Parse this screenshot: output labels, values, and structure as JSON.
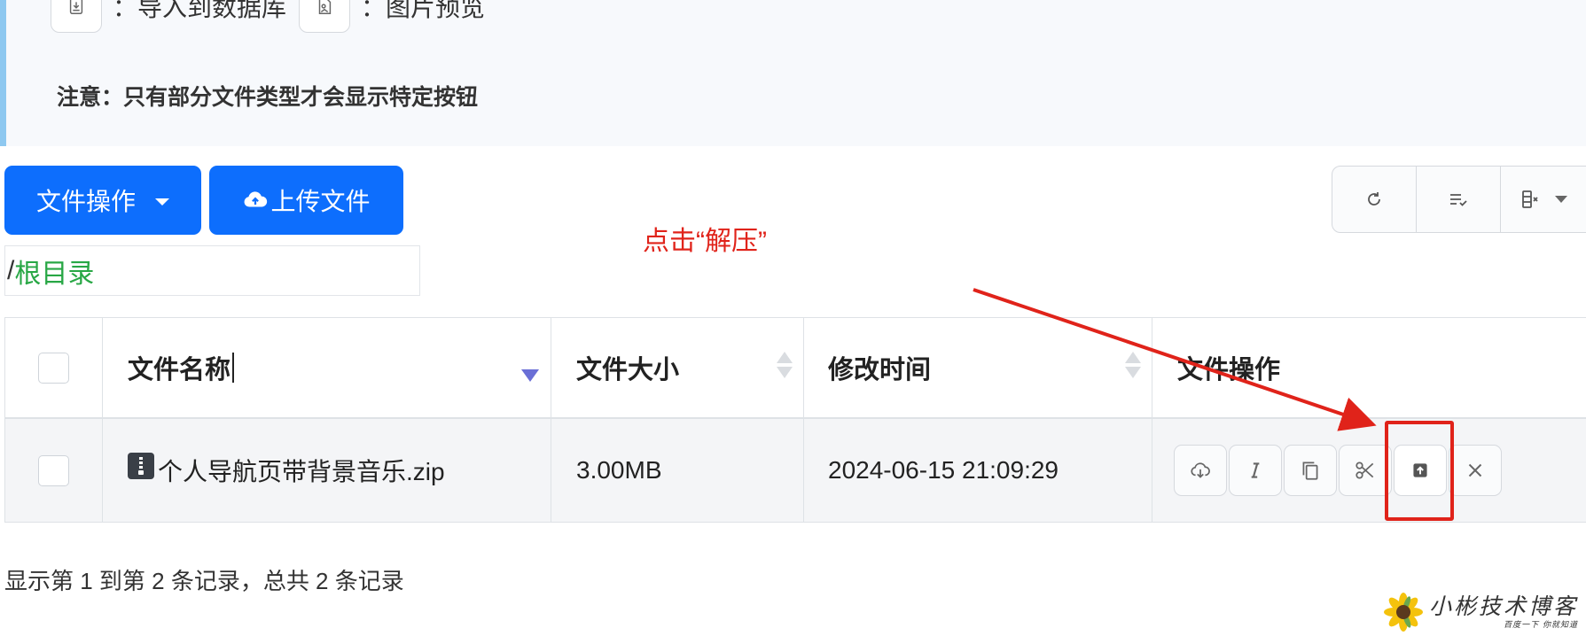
{
  "notice": {
    "legend_items": [
      {
        "icon": "import-database-icon",
        "text": "：导入到数据库"
      },
      {
        "icon": "image-preview-icon",
        "text": "：图片预览"
      }
    ],
    "note": "注意：只有部分文件类型才会显示特定按钮",
    "accent_color": "#8ec8f0"
  },
  "toolbar": {
    "file_ops_label": "文件操作",
    "upload_label": "上传文件",
    "primary_color": "#0d6efd",
    "right_tools": [
      {
        "icon": "refresh-icon"
      },
      {
        "icon": "toggle-view-icon"
      },
      {
        "icon": "columns-icon"
      }
    ]
  },
  "breadcrumb": {
    "separator": "/",
    "root": "根目录",
    "root_color": "#28a745"
  },
  "annotation": {
    "text": "点击“解压”",
    "color": "#e0231a"
  },
  "table": {
    "headers": {
      "name": "文件名称",
      "size": "文件大小",
      "modified": "修改时间",
      "ops": "文件操作"
    },
    "rows": [
      {
        "icon": "zip-file-icon",
        "name": "个人导航页带背景音乐.zip",
        "size": "3.00MB",
        "modified": "2024-06-15 21:09:29",
        "actions": [
          "download-icon",
          "rename-icon",
          "copy-icon",
          "cut-icon",
          "unzip-icon",
          "delete-icon"
        ]
      }
    ]
  },
  "pagination": {
    "info": "显示第 1 到第 2 条记录，总共 2 条记录"
  },
  "watermark": {
    "main": "小彬技术博客",
    "sub": "百度一下 你就知道"
  }
}
